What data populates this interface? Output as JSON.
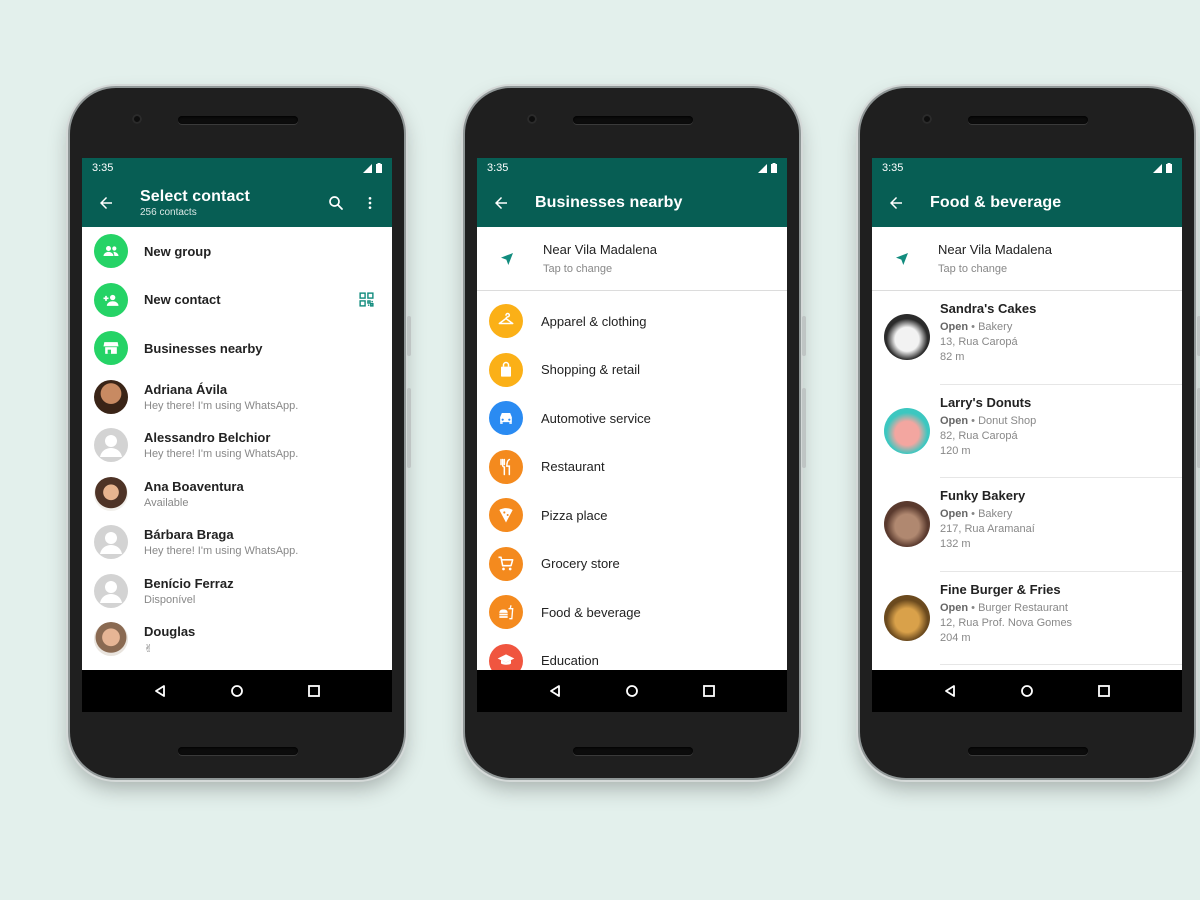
{
  "colors": {
    "background": "#e3f0ec",
    "whatsapp_teal": "#075e54",
    "green_icon": "#25d366",
    "qr_icon": "#128c7e"
  },
  "phone1": {
    "time": "3:35",
    "title": "Select contact",
    "subtitle": "256 contacts",
    "actions": [
      {
        "icon": "search-icon"
      },
      {
        "icon": "more-vert-icon"
      }
    ],
    "special_rows": [
      {
        "label": "New group",
        "icon": "group-icon"
      },
      {
        "label": "New contact",
        "icon": "person-add-icon",
        "trailing_icon": "qr-code-icon"
      },
      {
        "label": "Businesses nearby",
        "icon": "store-icon"
      }
    ],
    "contacts": [
      {
        "name": "Adriana Ávila",
        "status": "Hey there! I'm using WhatsApp.",
        "avatar": "photo"
      },
      {
        "name": "Alessandro Belchior",
        "status": "Hey there! I'm using WhatsApp.",
        "avatar": "default"
      },
      {
        "name": "Ana Boaventura",
        "status": "Available",
        "avatar": "photo"
      },
      {
        "name": "Bárbara Braga",
        "status": "Hey there! I'm using WhatsApp.",
        "avatar": "default"
      },
      {
        "name": "Benício Ferraz",
        "status": "Disponível",
        "avatar": "default"
      },
      {
        "name": "Douglas",
        "status": "✌",
        "avatar": "photo"
      }
    ]
  },
  "phone2": {
    "time": "3:35",
    "title": "Businesses nearby",
    "location": {
      "line1": "Near Vila Madalena",
      "line2": "Tap to change"
    },
    "categories": [
      {
        "label": "Apparel & clothing",
        "icon": "hanger-icon",
        "color": "#fbb017"
      },
      {
        "label": "Shopping & retail",
        "icon": "shopping-bag-icon",
        "color": "#fbb017"
      },
      {
        "label": "Automotive service",
        "icon": "car-icon",
        "color": "#2a8bf2"
      },
      {
        "label": "Restaurant",
        "icon": "restaurant-icon",
        "color": "#f48a1e"
      },
      {
        "label": "Pizza place",
        "icon": "pizza-icon",
        "color": "#f48a1e"
      },
      {
        "label": "Grocery store",
        "icon": "cart-icon",
        "color": "#f48a1e"
      },
      {
        "label": "Food & beverage",
        "icon": "fastfood-icon",
        "color": "#f48a1e"
      },
      {
        "label": "Education",
        "icon": "school-icon",
        "color": "#f0553f"
      }
    ]
  },
  "phone3": {
    "time": "3:35",
    "title": "Food & beverage",
    "location": {
      "line1": "Near Vila Madalena",
      "line2": "Tap to change"
    },
    "businesses": [
      {
        "name": "Sandra's Cakes",
        "open": "Open",
        "type": "Bakery",
        "address": "13, Rua Caropá",
        "distance": "82 m",
        "thumb_colors": [
          "#2b2b2b",
          "#f2f2f2"
        ]
      },
      {
        "name": "Larry's Donuts",
        "open": "Open",
        "type": "Donut Shop",
        "address": "82, Rua Caropá",
        "distance": "120 m",
        "thumb_colors": [
          "#3cc7c0",
          "#f3a6a0"
        ]
      },
      {
        "name": "Funky Bakery",
        "open": "Open",
        "type": "Bakery",
        "address": "217, Rua Aramanaí",
        "distance": "132 m",
        "thumb_colors": [
          "#5a3a2e",
          "#b08870"
        ]
      },
      {
        "name": "Fine Burger & Fries",
        "open": "Open",
        "type": "Burger Restaurant",
        "address": "12, Rua Prof. Nova Gomes",
        "distance": "204 m",
        "thumb_colors": [
          "#6b4a1e",
          "#d9a14a"
        ]
      }
    ]
  }
}
